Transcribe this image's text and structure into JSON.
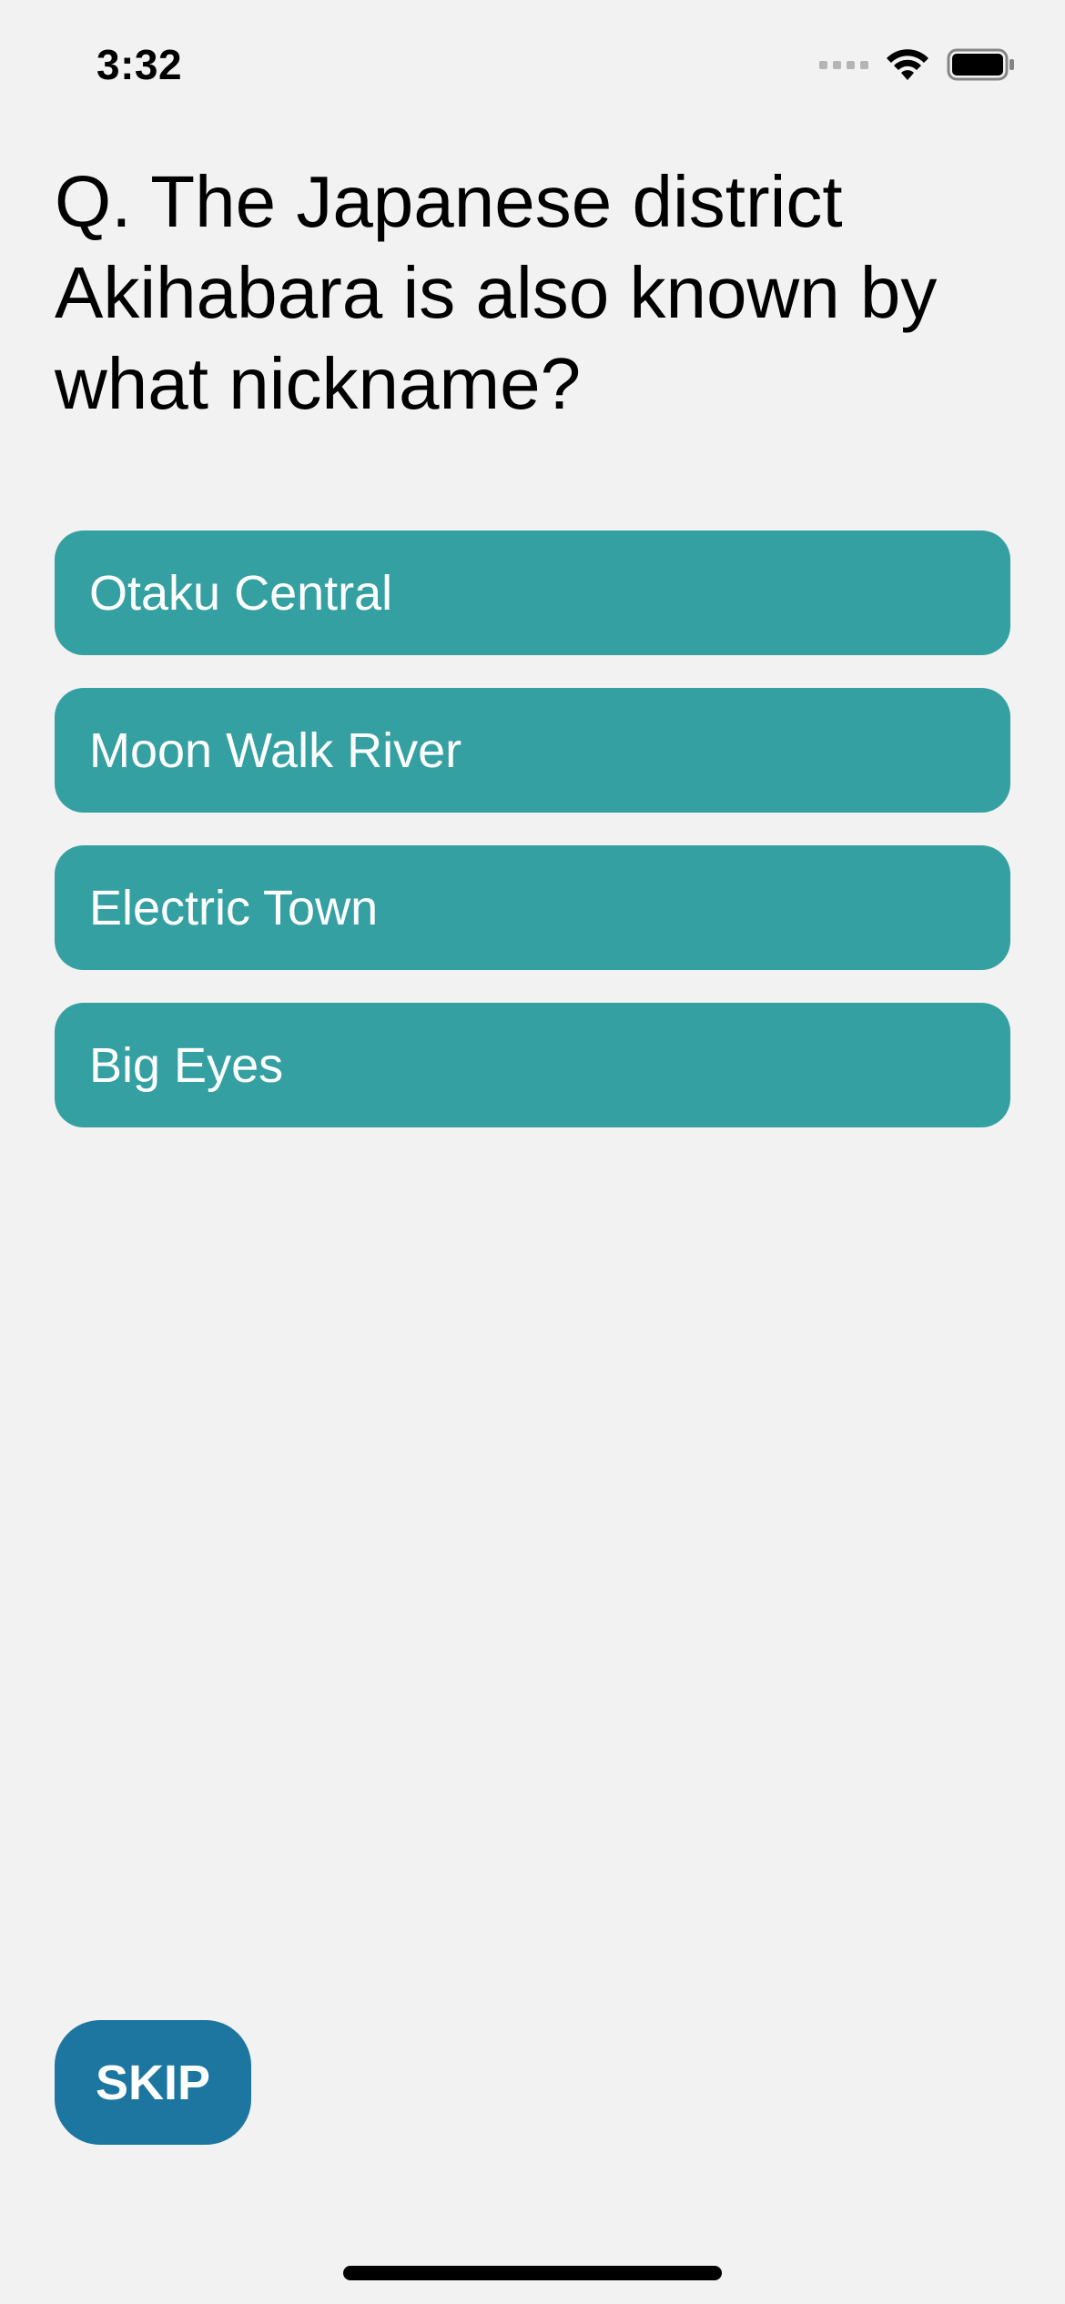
{
  "status_bar": {
    "time": "3:32",
    "icons": [
      "signal-icon",
      "wifi-icon",
      "battery-icon"
    ]
  },
  "question": {
    "text": "Q. The Japanese district Akihabara is also known by what nickname?"
  },
  "answers": [
    {
      "label": "Otaku Central"
    },
    {
      "label": "Moon Walk River"
    },
    {
      "label": "Electric Town"
    },
    {
      "label": "Big Eyes"
    }
  ],
  "skip_button": {
    "label": "SKIP"
  },
  "colors": {
    "background": "#f2f2f2",
    "answer_button": "#35a0a2",
    "skip_button": "#1c76a0",
    "button_text": "#ffffff"
  }
}
